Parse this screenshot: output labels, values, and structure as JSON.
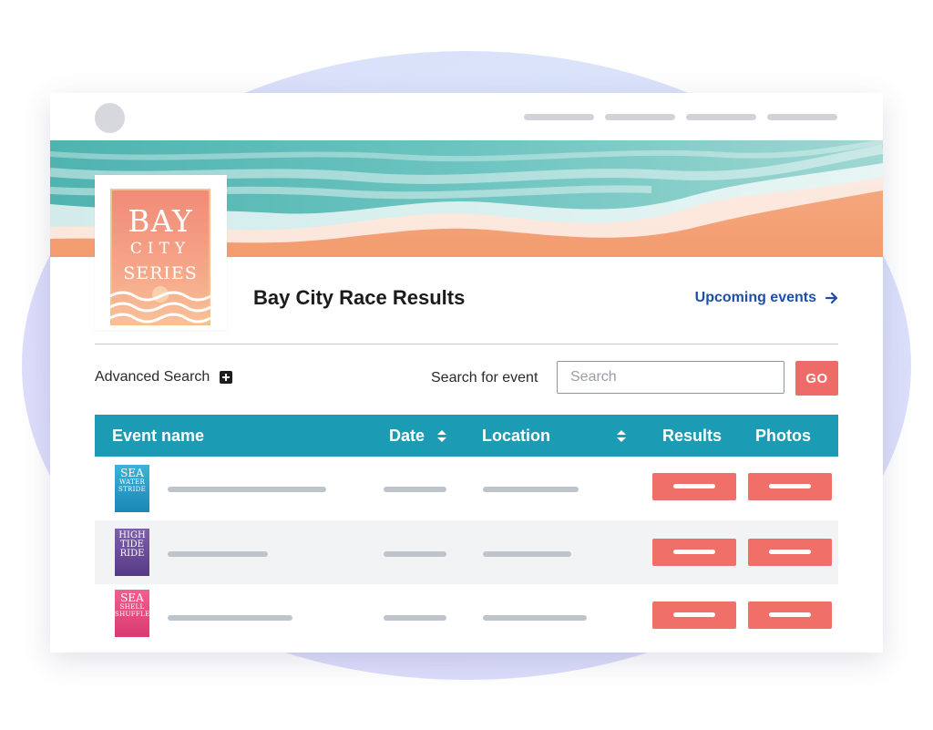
{
  "header": {
    "title": "Bay City Race Results",
    "upcoming_link": "Upcoming events"
  },
  "logo": {
    "line1": "BAY",
    "line2": "CITY",
    "line3": "SERIES"
  },
  "search": {
    "advanced_label": "Advanced Search",
    "label": "Search for event",
    "placeholder": "Search",
    "go_label": "GO"
  },
  "table": {
    "columns": [
      "Event name",
      "Date",
      "Location",
      "Results",
      "Photos"
    ],
    "rows": [
      {
        "thumb_lines": [
          "SEA",
          "WATER",
          "STRIDE"
        ],
        "thumb_colors": [
          "#2fa8cf",
          "#1a7fb0"
        ]
      },
      {
        "thumb_lines": [
          "HIGH",
          "TIDE",
          "RIDE"
        ],
        "thumb_colors": [
          "#7a5aa6",
          "#5d3f8a"
        ]
      },
      {
        "thumb_lines": [
          "SEA",
          "SHELL",
          "SHUFFLE"
        ],
        "thumb_colors": [
          "#ee5a8a",
          "#d9386f"
        ]
      }
    ]
  },
  "colors": {
    "accent": "#1c9bb5",
    "button": "#f16f69",
    "link": "#1d4fa8"
  }
}
